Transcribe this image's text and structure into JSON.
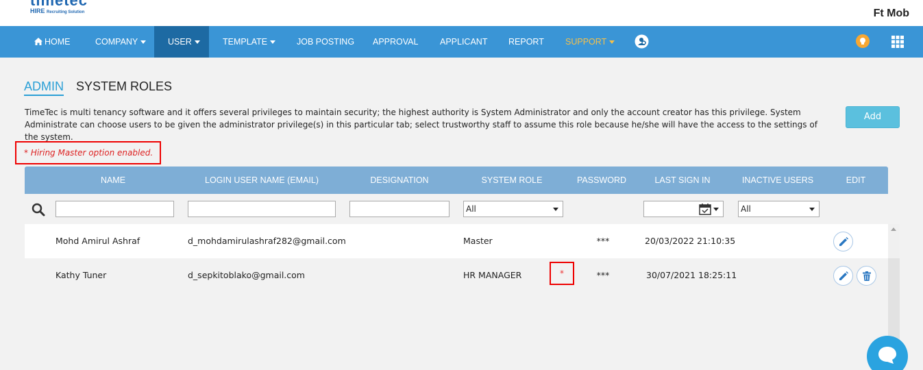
{
  "brand": {
    "logo_text": "timetec",
    "logo_sub_main": "HIRE",
    "logo_sub_tag": "Recruiting Solution"
  },
  "account": {
    "name": "Ft Mob"
  },
  "nav": {
    "home": "HOME",
    "company": "COMPANY",
    "user": "USER",
    "template": "TEMPLATE",
    "job_posting": "JOB POSTING",
    "approval": "APPROVAL",
    "applicant": "APPLICANT",
    "report": "REPORT",
    "support": "SUPPORT",
    "active_item": "USER"
  },
  "tabs": {
    "admin": "ADMIN",
    "system_roles": "SYSTEM ROLES",
    "active": "ADMIN"
  },
  "description": "TimeTec is multi tenancy software and it offers several privileges to maintain security; the highest authority is System Administrator and only the account creator has this privilege. System Administrate can choose users to be given the administrator privilege(s) in this particular tab; select trustworthy staff to assume this role because he/she will have the access to the settings of the system.",
  "add_button": "Add",
  "notice": "* Hiring Master option enabled.",
  "table": {
    "headers": {
      "name": "NAME",
      "login": "LOGIN USER NAME (EMAIL)",
      "designation": "DESIGNATION",
      "system_role": "SYSTEM ROLE",
      "password": "PASSWORD",
      "last_sign_in": "LAST SIGN IN",
      "inactive_users": "INACTIVE USERS",
      "edit": "EDIT"
    },
    "filters": {
      "system_role": "All",
      "inactive_users": "All"
    },
    "rows": [
      {
        "name": "Mohd Amirul Ashraf",
        "email": "d_mohdamirulashraf282@gmail.com",
        "designation": "",
        "role": "Master",
        "master_mark": "",
        "password": "***",
        "last_sign_in": "20/03/2022 21:10:35"
      },
      {
        "name": "Kathy Tuner",
        "email": "d_sepkitoblako@gmail.com",
        "designation": "",
        "role": "HR MANAGER",
        "master_mark": "*",
        "password": "***",
        "last_sign_in": "30/07/2021 18:25:11"
      }
    ]
  },
  "colors": {
    "navbar": "#3a95d6",
    "nav_active": "#1d6aa3",
    "support": "#f5c04a",
    "header": "#7eaed6",
    "accent": "#2a9fd6",
    "add_button": "#5bc0de",
    "alert": "#e00000"
  }
}
